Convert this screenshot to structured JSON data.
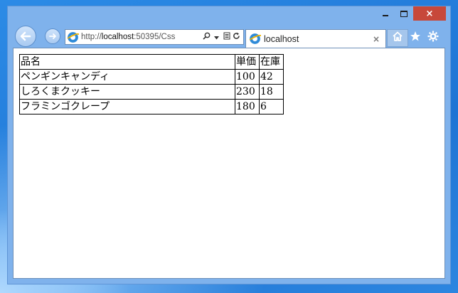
{
  "browser": {
    "address_url_prefix": "http://",
    "address_url_host": "localhost",
    "address_url_rest": ":50395/Css",
    "tab_title": "localhost",
    "tab_close": "×",
    "caption_close": "×"
  },
  "icons": {
    "back": "back-arrow-icon",
    "forward": "forward-arrow-icon",
    "site": "ie-page-icon",
    "search": "search-icon",
    "dropdown": "chevron-down-icon",
    "compat": "compatibility-view-icon",
    "refresh": "refresh-icon",
    "home": "home-icon",
    "favorites": "star-icon",
    "tools": "gear-icon"
  },
  "table": {
    "headers": [
      "品名",
      "単価",
      "在庫"
    ],
    "rows": [
      [
        "ペンギンキャンディ",
        "100",
        "42"
      ],
      [
        "しろくまクッキー",
        "230",
        "18"
      ],
      [
        "フラミンゴクレープ",
        "180",
        "6"
      ]
    ]
  }
}
